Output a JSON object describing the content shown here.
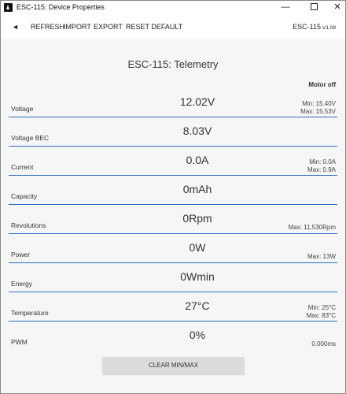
{
  "window": {
    "title": "ESC-115: Device Properties",
    "controls": {
      "minimize": "—",
      "close": "✕"
    }
  },
  "toolbar": {
    "back_glyph": "◄",
    "refresh": "REFRESH",
    "import": "IMPORT",
    "export": "EXPORT",
    "reset_default": "RESET DEFAULT",
    "device_name": "ESC-115",
    "version": "V1.09"
  },
  "telemetry": {
    "title": "ESC-115: Telemetry",
    "motor_state": "Motor off",
    "rows": [
      {
        "label": "Voltage",
        "value": "12.02V",
        "min": "Min: 15.40V",
        "max": "Max: 15.53V"
      },
      {
        "label": "Voltage BEC",
        "value": "8.03V",
        "min": "",
        "max": ""
      },
      {
        "label": "Current",
        "value": "0.0A",
        "min": "Min: 0.0A",
        "max": "Max: 0.9A"
      },
      {
        "label": "Capacity",
        "value": "0mAh",
        "min": "",
        "max": ""
      },
      {
        "label": "Revolutions",
        "value": "0Rpm",
        "min": "",
        "max": "Max: 11,530Rpm"
      },
      {
        "label": "Power",
        "value": "0W",
        "min": "",
        "max": "Max: 13W"
      },
      {
        "label": "Energy",
        "value": "0Wmin",
        "min": "",
        "max": ""
      },
      {
        "label": "Temperature",
        "value": "27°C",
        "min": "Min: 25°C",
        "max": "Max: 83°C"
      },
      {
        "label": "PWM",
        "value": "0%",
        "min": "",
        "max": "0.000ms"
      }
    ],
    "clear_button": "CLEAR MIN/MAX"
  },
  "colors": {
    "separator": "#2f6dc0",
    "content_bg": "#f6f6f6",
    "button_bg": "#dcdcdc"
  }
}
